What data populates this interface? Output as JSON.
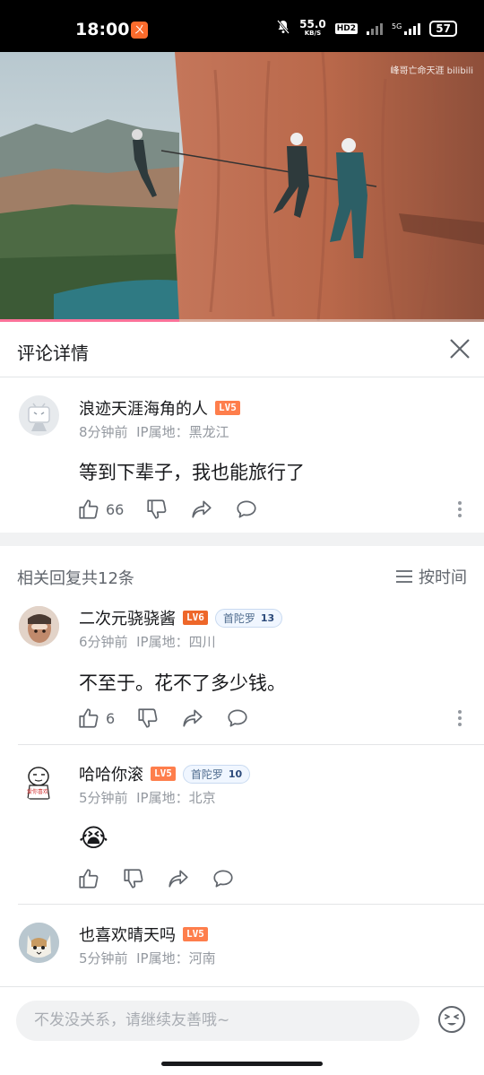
{
  "status_bar": {
    "time": "18:00",
    "app_icon_glyph": "ㄨ",
    "net_speed": "55.0",
    "net_unit": "KB/S",
    "hd_label": "HD2",
    "network_label": "5G",
    "battery": "57"
  },
  "video": {
    "watermark": "峰哥亡命天涯  bilibili",
    "progress_fraction": 0.37
  },
  "header": {
    "title": "评论详情"
  },
  "main_comment": {
    "username": "浪迹天涯海角的人",
    "level": "LV5",
    "time": "8分钟前",
    "ip": "IP属地：黑龙江",
    "text": "等到下辈子，我也能旅行了",
    "likes": "66"
  },
  "replies_header": {
    "count_label": "相关回复共12条",
    "sort_label": "按时间"
  },
  "replies": [
    {
      "username": "二次元骁骁酱",
      "level": "LV6",
      "medal_name": "首陀罗",
      "medal_level": "13",
      "time": "6分钟前",
      "ip": "IP属地：四川",
      "text": "不至于。花不了多少钱。",
      "likes": "6"
    },
    {
      "username": "哈哈你滚",
      "level": "LV5",
      "medal_name": "首陀罗",
      "medal_level": "10",
      "time": "5分钟前",
      "ip": "IP属地：北京",
      "emoji": "😭",
      "avatar_caption": "爱你喜欢"
    },
    {
      "username": "也喜欢晴天吗",
      "level": "LV5",
      "time": "5分钟前",
      "ip": "IP属地：河南"
    }
  ],
  "bottom": {
    "input_placeholder": "不发没关系，请继续友善哦~"
  },
  "colors": {
    "accent_pink": "#fb7299",
    "level_orange": "#fe7e4c",
    "meta_gray": "#9499a0"
  }
}
